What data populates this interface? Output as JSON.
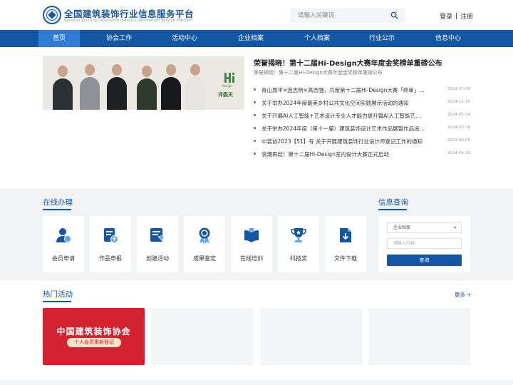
{
  "header": {
    "site_title": "全国建筑装饰行业信息服务平台",
    "site_subtitle": "National Building Decoration Industry Information Service Platform",
    "search_placeholder": "请输入关键词",
    "login": "登录",
    "register": "注册"
  },
  "nav": {
    "items": [
      {
        "label": "首页",
        "active": true
      },
      {
        "label": "协会工作"
      },
      {
        "label": "活动中心"
      },
      {
        "label": "企业档案"
      },
      {
        "label": "个人档案"
      },
      {
        "label": "行业公示"
      },
      {
        "label": "信息中心"
      }
    ]
  },
  "banner": {
    "logo_text": "Hi",
    "logo_sub": "Design",
    "badge_vertical": "第十二届",
    "badge_caption": "评委天"
  },
  "news": {
    "headline": "荣誉揭晓！第十二届Hi-Design大赛年度金奖榜单重磅公布",
    "subline": "荣誉揭晓！第十二届Hi-Design大赛年度金奖榜单重磅公布",
    "items": [
      {
        "title": "青山周平×连志明×高志强，共度第十二届Hi-Design大赛「终审」时刻",
        "date": "2024-11-08"
      },
      {
        "title": "关于举办2024年度最美乡村公共文化空间实践展示活动的通知",
        "date": "2024-11-15"
      },
      {
        "title": "关于开展AI人工智能+艺术设计专业人才能力提升暨AI人工智能艺术设计师培训的通知",
        "date": "2024-05-14"
      },
      {
        "title": "关于举办2024年度（第十一届）建筑装饰设计艺术作品展暨作品设计大赛的通知",
        "date": "2024-03-28"
      },
      {
        "title": "中装协2023【51】号 关于开展建筑装饰行业设计师登记工作的通知",
        "date": "2023-06-08"
      },
      {
        "title": "浪潮再起！第十二届Hi-Design室内设计大赛正式启动",
        "date": "2024-04-10"
      }
    ]
  },
  "online": {
    "title": "在线办理",
    "cards": [
      {
        "label": "会员申请",
        "icon": "member-icon"
      },
      {
        "label": "作品申报",
        "icon": "upload-document-icon"
      },
      {
        "label": "创建活动",
        "icon": "create-activity-icon"
      },
      {
        "label": "成果鉴定",
        "icon": "award-ribbon-icon"
      },
      {
        "label": "在线培训",
        "icon": "open-book-icon"
      },
      {
        "label": "科技奖",
        "icon": "trophy-icon"
      },
      {
        "label": "文件下载",
        "icon": "download-file-icon"
      }
    ]
  },
  "info_query": {
    "title": "信息查询",
    "select_value": "企业档案",
    "input_placeholder": "请输入内容",
    "button": "查询"
  },
  "hot": {
    "title": "热门活动",
    "more": "更多 +",
    "promo_title": "中国建筑装饰协会",
    "promo_tag": "个人会员重新登记"
  },
  "colors": {
    "brand_blue": "#1456a6",
    "nav_active": "#2f7bd6",
    "promo_red": "#d42330"
  }
}
